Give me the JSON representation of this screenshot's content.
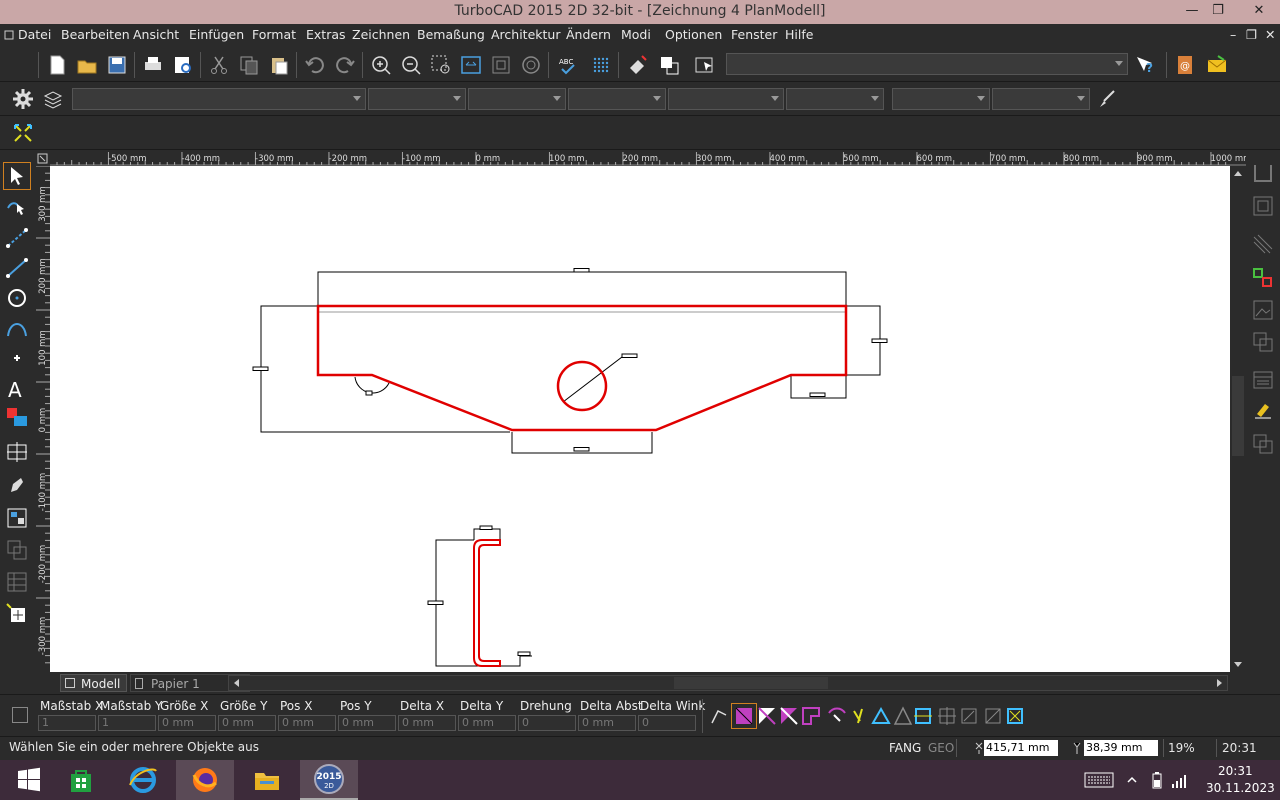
{
  "window": {
    "title": "TurboCAD 2015 2D 32-bit - [Zeichnung 4 PlanModell]",
    "minimize_glyph": "—",
    "restore_glyph": "❐",
    "close_glyph": "✕"
  },
  "menu": {
    "items": [
      "Datei",
      "Bearbeiten",
      "Ansicht",
      "Einfügen",
      "Format",
      "Extras",
      "Zeichnen",
      "Bemaßung",
      "Architektur",
      "Ändern",
      "Modi",
      "Optionen",
      "Fenster",
      "Hilfe"
    ],
    "mdi_minimize": "–",
    "mdi_restore": "❐",
    "mdi_close": "✕"
  },
  "ruler": {
    "top_labels": [
      "-500 mm",
      "-400 mm",
      "-300 mm",
      "-200 mm",
      "-100 mm",
      "0 mm",
      "100 mm",
      "200 mm",
      "300 mm",
      "400 mm",
      "500 mm",
      "600 mm",
      "700 mm",
      "800 mm",
      "900 mm",
      "1000 mm"
    ],
    "left_labels": [
      "300 mm",
      "200 mm",
      "100 mm",
      "0 mm",
      "-100 mm",
      "-200 mm",
      "-300 mm"
    ]
  },
  "tabs": [
    {
      "label": "Modell",
      "active": true
    },
    {
      "label": "Papier 1",
      "active": false
    }
  ],
  "coord_fields": [
    {
      "label": "Maßstab X",
      "value": "1"
    },
    {
      "label": "Maßstab Y",
      "value": "1"
    },
    {
      "label": "Größe X",
      "value": "0 mm"
    },
    {
      "label": "Größe Y",
      "value": "0 mm"
    },
    {
      "label": "Pos X",
      "value": "0 mm"
    },
    {
      "label": "Pos Y",
      "value": "0 mm"
    },
    {
      "label": "Delta X",
      "value": "0 mm"
    },
    {
      "label": "Delta Y",
      "value": "0 mm"
    },
    {
      "label": "Drehung",
      "value": "0"
    },
    {
      "label": "Delta Abst",
      "value": "0 mm"
    },
    {
      "label": "Delta Wink",
      "value": "0"
    }
  ],
  "status": {
    "message": "Wählen Sie ein oder mehrere Objekte aus",
    "fang": "FANG",
    "geo": "GEO",
    "x_coord": "415,71 mm",
    "y_coord": "38,39 mm",
    "zoom": "19%",
    "time": "20:31"
  },
  "taskbar": {
    "time": "20:31",
    "date": "30.11.2023",
    "turbocad_badge": "2015",
    "turbocad_sub": "2D"
  },
  "colors": {
    "drawing_red": "#e00000",
    "canvas_bg": "#ffffff",
    "ui_bg": "#2b2b2b",
    "titlebar": "#c9a7a7",
    "taskbar": "#3d2b3a"
  },
  "icons": {
    "toolbar_main": [
      "new-file-icon",
      "open-folder-icon",
      "save-icon",
      "print-icon",
      "print-preview-icon",
      "cut-icon",
      "copy-icon",
      "paste-icon",
      "undo-icon",
      "redo-icon",
      "zoom-in-icon",
      "zoom-out-icon",
      "zoom-window-icon",
      "zoom-extents-icon",
      "zoom-page-icon",
      "zoom-previous-icon",
      "spell-check-icon",
      "grid-icon",
      "eraser-icon",
      "copy-properties-icon",
      "help-pointer-icon",
      "whatsthis-icon",
      "address-book-icon",
      "mail-icon"
    ],
    "left_tools": [
      "select-arrow-icon",
      "node-edit-icon",
      "polyline-icon",
      "line-icon",
      "circle-icon",
      "arc-icon",
      "point-icon",
      "text-icon",
      "color-fill-icon",
      "move-icon",
      "pencil-icon",
      "block-icon",
      "group-icon",
      "table-icon",
      "insert-icon"
    ],
    "right_tools": [
      "union-icon",
      "offset-icon",
      "hatch-icon",
      "snap-settings-icon",
      "image-icon",
      "layers-icon",
      "properties-icon",
      "highlight-icon",
      "explode-icon"
    ]
  }
}
